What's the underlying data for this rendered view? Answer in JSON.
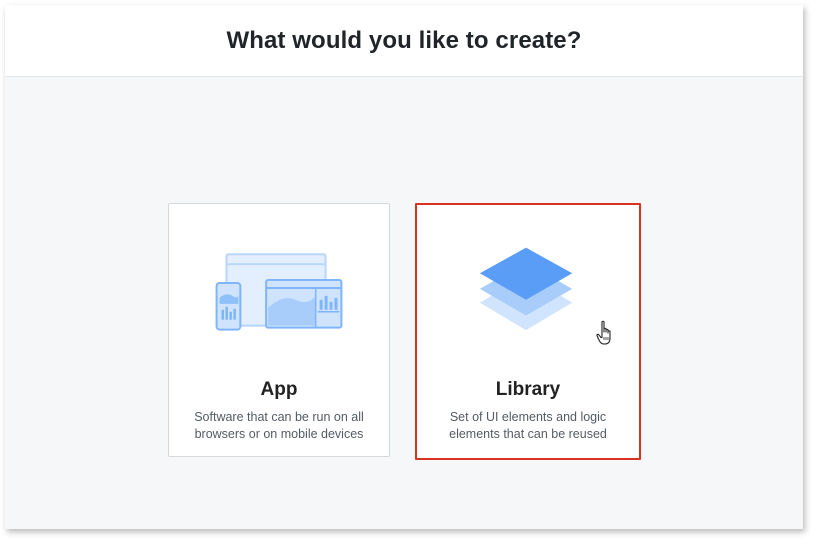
{
  "header": {
    "title": "What would you like to create?"
  },
  "options": [
    {
      "title": "App",
      "description_line1": "Software that can be run on all",
      "description_line2": "browsers or on mobile devices",
      "icon": "app-devices-icon"
    },
    {
      "title": "Library",
      "description_line1": "Set of UI elements and logic",
      "description_line2": "elements that can be reused",
      "icon": "layers-icon",
      "selected": true
    }
  ],
  "colors": {
    "selected_border": "#d9321f",
    "accent_blue": "#5a9df7",
    "light_blue": "#a9cdfb",
    "background": "#f6f7f9"
  }
}
